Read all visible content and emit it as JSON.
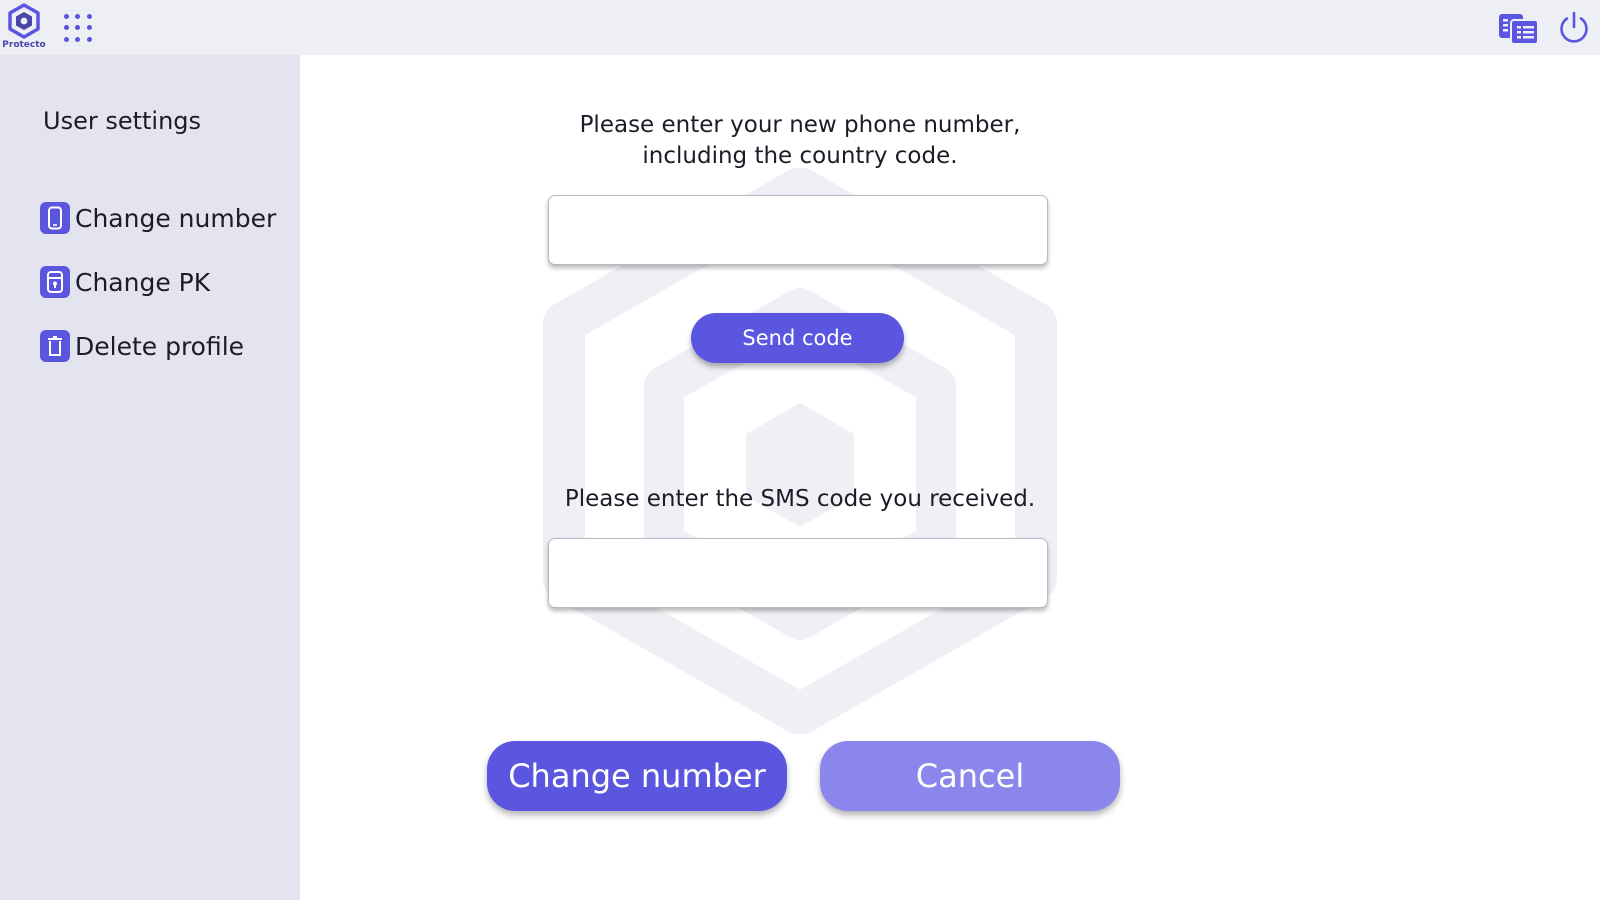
{
  "app": {
    "name": "Protecto",
    "accent_color": "#5b56e0"
  },
  "topbar": {
    "logo_icon": "protecto-logo-icon",
    "apps_icon": "apps-grid-icon",
    "translate_icon": "translate-icon",
    "power_icon": "power-icon"
  },
  "sidebar": {
    "title": "User settings",
    "items": [
      {
        "label": "Change number",
        "icon": "phone-icon"
      },
      {
        "label": "Change PK",
        "icon": "key-lock-icon"
      },
      {
        "label": "Delete profile",
        "icon": "trash-icon"
      }
    ]
  },
  "main": {
    "phone_prompt_line1": "Please enter your new phone number,",
    "phone_prompt_line2": "including the country code.",
    "phone_value": "",
    "send_code_label": "Send code",
    "sms_prompt": "Please enter the SMS code you received.",
    "sms_value": "",
    "change_number_label": "Change number",
    "cancel_label": "Cancel"
  }
}
